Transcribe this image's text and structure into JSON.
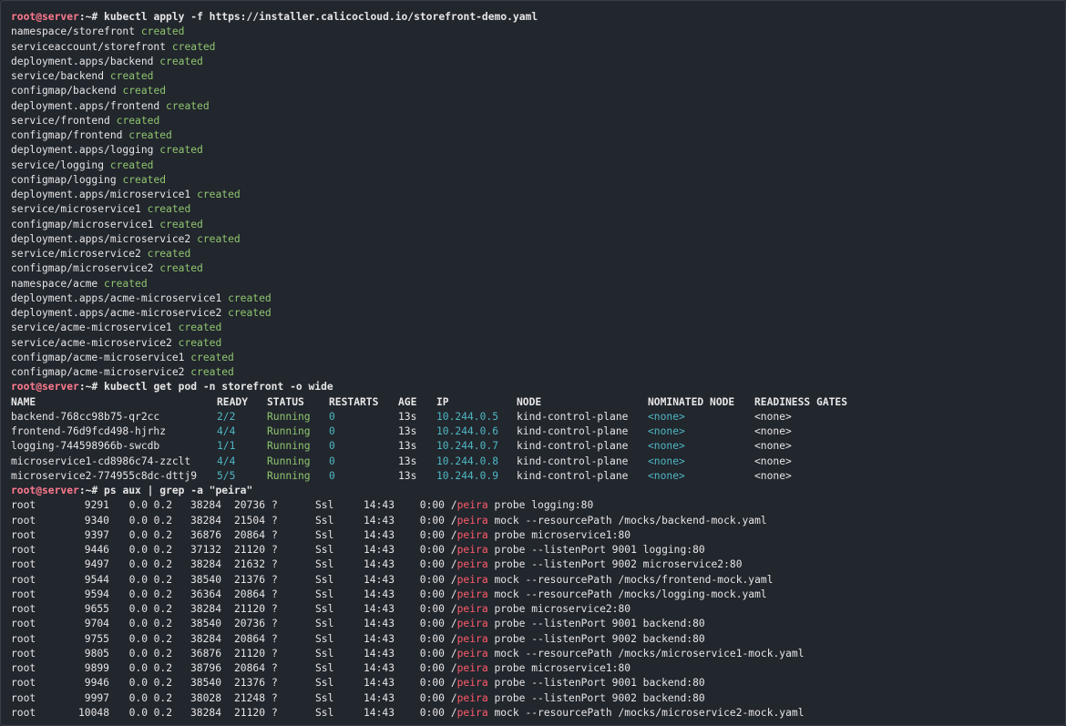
{
  "prompt": {
    "user_host": "root@server",
    "suffix": ":~# "
  },
  "commands": {
    "apply": "kubectl apply -f https://installer.calicocloud.io/storefront-demo.yaml",
    "get_pod": "kubectl get pod -n storefront -o wide",
    "ps": "ps aux | grep -a \"peira\""
  },
  "apply_output": [
    {
      "resource": "namespace/storefront",
      "status": "created"
    },
    {
      "resource": "serviceaccount/storefront",
      "status": "created"
    },
    {
      "resource": "deployment.apps/backend",
      "status": "created"
    },
    {
      "resource": "service/backend",
      "status": "created"
    },
    {
      "resource": "configmap/backend",
      "status": "created"
    },
    {
      "resource": "deployment.apps/frontend",
      "status": "created"
    },
    {
      "resource": "service/frontend",
      "status": "created"
    },
    {
      "resource": "configmap/frontend",
      "status": "created"
    },
    {
      "resource": "deployment.apps/logging",
      "status": "created"
    },
    {
      "resource": "service/logging",
      "status": "created"
    },
    {
      "resource": "configmap/logging",
      "status": "created"
    },
    {
      "resource": "deployment.apps/microservice1",
      "status": "created"
    },
    {
      "resource": "service/microservice1",
      "status": "created"
    },
    {
      "resource": "configmap/microservice1",
      "status": "created"
    },
    {
      "resource": "deployment.apps/microservice2",
      "status": "created"
    },
    {
      "resource": "service/microservice2",
      "status": "created"
    },
    {
      "resource": "configmap/microservice2",
      "status": "created"
    },
    {
      "resource": "namespace/acme",
      "status": "created"
    },
    {
      "resource": "deployment.apps/acme-microservice1",
      "status": "created"
    },
    {
      "resource": "deployment.apps/acme-microservice2",
      "status": "created"
    },
    {
      "resource": "service/acme-microservice1",
      "status": "created"
    },
    {
      "resource": "service/acme-microservice2",
      "status": "created"
    },
    {
      "resource": "configmap/acme-microservice1",
      "status": "created"
    },
    {
      "resource": "configmap/acme-microservice2",
      "status": "created"
    }
  ],
  "pods": {
    "headers": [
      "NAME",
      "READY",
      "STATUS",
      "RESTARTS",
      "AGE",
      "IP",
      "NODE",
      "NOMINATED NODE",
      "READINESS GATES"
    ],
    "rows": [
      [
        "backend-768cc98b75-qr2cc",
        "2/2",
        "Running",
        "0",
        "13s",
        "10.244.0.5",
        "kind-control-plane",
        "<none>",
        "<none>"
      ],
      [
        "frontend-76d9fcd498-hjrhz",
        "4/4",
        "Running",
        "0",
        "13s",
        "10.244.0.6",
        "kind-control-plane",
        "<none>",
        "<none>"
      ],
      [
        "logging-744598966b-swcdb",
        "1/1",
        "Running",
        "0",
        "13s",
        "10.244.0.7",
        "kind-control-plane",
        "<none>",
        "<none>"
      ],
      [
        "microservice1-cd8986c74-zzclt",
        "4/4",
        "Running",
        "0",
        "13s",
        "10.244.0.8",
        "kind-control-plane",
        "<none>",
        "<none>"
      ],
      [
        "microservice2-774955c8dc-dttj9",
        "5/5",
        "Running",
        "0",
        "13s",
        "10.244.0.9",
        "kind-control-plane",
        "<none>",
        "<none>"
      ]
    ]
  },
  "processes": [
    {
      "user": "root",
      "pid": "9291",
      "cpu": "0.0",
      "mem": "0.2",
      "vsz": "38284",
      "rss": "20736",
      "tty": "?",
      "stat": "Ssl",
      "start": "14:43",
      "time": "0:00",
      "bin_prefix": "/",
      "bin": "peira",
      "args": " probe logging:80"
    },
    {
      "user": "root",
      "pid": "9340",
      "cpu": "0.0",
      "mem": "0.2",
      "vsz": "38284",
      "rss": "21504",
      "tty": "?",
      "stat": "Ssl",
      "start": "14:43",
      "time": "0:00",
      "bin_prefix": "/",
      "bin": "peira",
      "args": " mock --resourcePath /mocks/backend-mock.yaml"
    },
    {
      "user": "root",
      "pid": "9397",
      "cpu": "0.0",
      "mem": "0.2",
      "vsz": "36876",
      "rss": "20864",
      "tty": "?",
      "stat": "Ssl",
      "start": "14:43",
      "time": "0:00",
      "bin_prefix": "/",
      "bin": "peira",
      "args": " probe microservice1:80"
    },
    {
      "user": "root",
      "pid": "9446",
      "cpu": "0.0",
      "mem": "0.2",
      "vsz": "37132",
      "rss": "21120",
      "tty": "?",
      "stat": "Ssl",
      "start": "14:43",
      "time": "0:00",
      "bin_prefix": "/",
      "bin": "peira",
      "args": " probe --listenPort 9001 logging:80"
    },
    {
      "user": "root",
      "pid": "9497",
      "cpu": "0.0",
      "mem": "0.2",
      "vsz": "38284",
      "rss": "21632",
      "tty": "?",
      "stat": "Ssl",
      "start": "14:43",
      "time": "0:00",
      "bin_prefix": "/",
      "bin": "peira",
      "args": " probe --listenPort 9002 microservice2:80"
    },
    {
      "user": "root",
      "pid": "9544",
      "cpu": "0.0",
      "mem": "0.2",
      "vsz": "38540",
      "rss": "21376",
      "tty": "?",
      "stat": "Ssl",
      "start": "14:43",
      "time": "0:00",
      "bin_prefix": "/",
      "bin": "peira",
      "args": " mock --resourcePath /mocks/frontend-mock.yaml"
    },
    {
      "user": "root",
      "pid": "9594",
      "cpu": "0.0",
      "mem": "0.2",
      "vsz": "36364",
      "rss": "20864",
      "tty": "?",
      "stat": "Ssl",
      "start": "14:43",
      "time": "0:00",
      "bin_prefix": "/",
      "bin": "peira",
      "args": " mock --resourcePath /mocks/logging-mock.yaml"
    },
    {
      "user": "root",
      "pid": "9655",
      "cpu": "0.0",
      "mem": "0.2",
      "vsz": "38284",
      "rss": "21120",
      "tty": "?",
      "stat": "Ssl",
      "start": "14:43",
      "time": "0:00",
      "bin_prefix": "/",
      "bin": "peira",
      "args": " probe microservice2:80"
    },
    {
      "user": "root",
      "pid": "9704",
      "cpu": "0.0",
      "mem": "0.2",
      "vsz": "38540",
      "rss": "20736",
      "tty": "?",
      "stat": "Ssl",
      "start": "14:43",
      "time": "0:00",
      "bin_prefix": "/",
      "bin": "peira",
      "args": " probe --listenPort 9001 backend:80"
    },
    {
      "user": "root",
      "pid": "9755",
      "cpu": "0.0",
      "mem": "0.2",
      "vsz": "38284",
      "rss": "20864",
      "tty": "?",
      "stat": "Ssl",
      "start": "14:43",
      "time": "0:00",
      "bin_prefix": "/",
      "bin": "peira",
      "args": " probe --listenPort 9002 backend:80"
    },
    {
      "user": "root",
      "pid": "9805",
      "cpu": "0.0",
      "mem": "0.2",
      "vsz": "36876",
      "rss": "21120",
      "tty": "?",
      "stat": "Ssl",
      "start": "14:43",
      "time": "0:00",
      "bin_prefix": "/",
      "bin": "peira",
      "args": " mock --resourcePath /mocks/microservice1-mock.yaml"
    },
    {
      "user": "root",
      "pid": "9899",
      "cpu": "0.0",
      "mem": "0.2",
      "vsz": "38796",
      "rss": "20864",
      "tty": "?",
      "stat": "Ssl",
      "start": "14:43",
      "time": "0:00",
      "bin_prefix": "/",
      "bin": "peira",
      "args": " probe microservice1:80"
    },
    {
      "user": "root",
      "pid": "9946",
      "cpu": "0.0",
      "mem": "0.2",
      "vsz": "38540",
      "rss": "21376",
      "tty": "?",
      "stat": "Ssl",
      "start": "14:43",
      "time": "0:00",
      "bin_prefix": "/",
      "bin": "peira",
      "args": " probe --listenPort 9001 backend:80"
    },
    {
      "user": "root",
      "pid": "9997",
      "cpu": "0.0",
      "mem": "0.2",
      "vsz": "38028",
      "rss": "21248",
      "tty": "?",
      "stat": "Ssl",
      "start": "14:43",
      "time": "0:00",
      "bin_prefix": "/",
      "bin": "peira",
      "args": " probe --listenPort 9002 backend:80"
    },
    {
      "user": "root",
      "pid": "10048",
      "cpu": "0.0",
      "mem": "0.2",
      "vsz": "38284",
      "rss": "21120",
      "tty": "?",
      "stat": "Ssl",
      "start": "14:43",
      "time": "0:00",
      "bin_prefix": "/",
      "bin": "peira",
      "args": " mock --resourcePath /mocks/microservice2-mock.yaml"
    }
  ],
  "colors": {
    "background": "#22262d",
    "prompt": "#ff7a8e",
    "created": "#8fc66f",
    "cyan": "#4eb8c4",
    "highlight": "#ff5c6a"
  }
}
